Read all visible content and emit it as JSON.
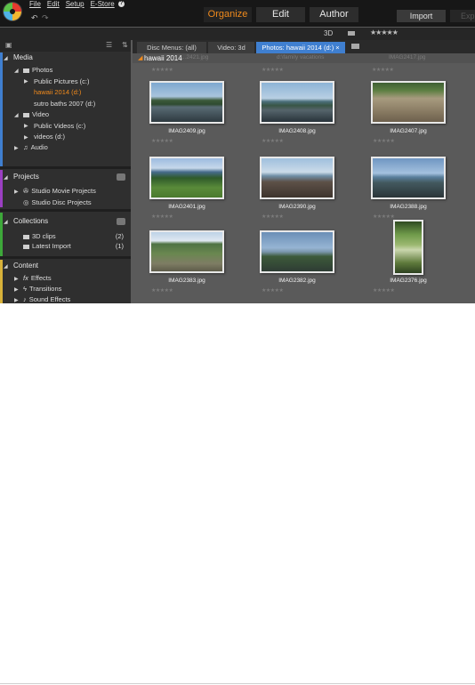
{
  "app": {
    "menu": [
      "File",
      "Edit",
      "Setup",
      "E-Store"
    ],
    "help_label": "?",
    "undo_icon": "undo-arrow-icon",
    "redo_icon": "redo-arrow-icon",
    "modes": [
      {
        "label": "Organize",
        "active": true
      },
      {
        "label": "Edit",
        "active": false
      },
      {
        "label": "Author",
        "active": false
      }
    ],
    "import_label": "Import",
    "export_label": "Exp"
  },
  "toolbar": {
    "three_d_label": "3D",
    "rating_filter": "★★★★★"
  },
  "sidebar": {
    "media": {
      "title": "Media",
      "items": [
        {
          "label": "Photos",
          "level": 1,
          "selected": false
        },
        {
          "label": "Public Pictures (c:)",
          "level": 2,
          "selected": false
        },
        {
          "label": "hawaii 2014 (d:)",
          "level": 3,
          "selected": true
        },
        {
          "label": "sutro baths 2007 (d:)",
          "level": 3,
          "selected": false
        },
        {
          "label": "Video",
          "level": 1,
          "selected": false
        },
        {
          "label": "Public Videos (c:)",
          "level": 2,
          "selected": false
        },
        {
          "label": "videos (d:)",
          "level": 2,
          "selected": false
        },
        {
          "label": "Audio",
          "level": 1,
          "selected": false
        }
      ]
    },
    "projects": {
      "title": "Projects",
      "items": [
        {
          "label": "Studio Movie Projects"
        },
        {
          "label": "Studio Disc Projects"
        }
      ]
    },
    "collections": {
      "title": "Collections",
      "items": [
        {
          "label": "3D clips",
          "count": "(2)"
        },
        {
          "label": "Latest Import",
          "count": "(1)"
        }
      ]
    },
    "content": {
      "title": "Content",
      "items": [
        {
          "label": "Effects"
        },
        {
          "label": "Transitions"
        },
        {
          "label": "Sound Effects"
        }
      ]
    }
  },
  "tabs": [
    {
      "label": "Disc Menus: (all)",
      "active": false
    },
    {
      "label": "Video: 3d",
      "active": false
    },
    {
      "label": "Photos: hawaii 2014 (d:)",
      "active": true,
      "close": "×"
    }
  ],
  "library": {
    "current_folder": "hawaii 2014",
    "ghost_left": "...2421.jpg",
    "ghost_center": "d:\\family vacations",
    "ghost_right": "IMAG2417.jpg",
    "stars": "★★★★★",
    "photos": [
      {
        "name": "IMAG2409.jpg",
        "scene": "coast"
      },
      {
        "name": "IMAG2408.jpg",
        "scene": "coast2"
      },
      {
        "name": "IMAG2407.jpg",
        "scene": "pool"
      },
      {
        "name": "IMAG2401.jpg",
        "scene": "cliff"
      },
      {
        "name": "IMAG2390.jpg",
        "scene": "rocks"
      },
      {
        "name": "IMAG2388.jpg",
        "scene": "shore"
      },
      {
        "name": "IMAG2383.jpg",
        "scene": "bay"
      },
      {
        "name": "IMAG2382.jpg",
        "scene": "headland"
      },
      {
        "name": "IMAG2376.jpg",
        "scene": "jungle"
      }
    ]
  }
}
